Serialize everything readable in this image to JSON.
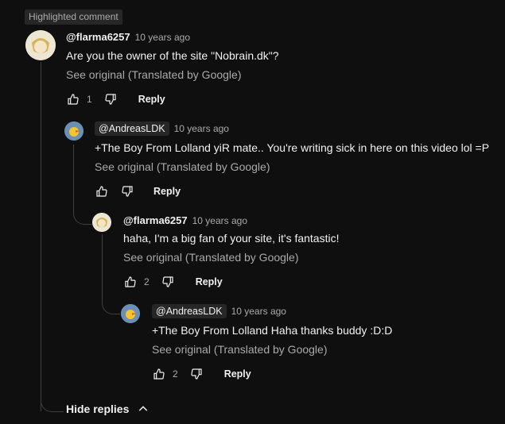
{
  "highlight_badge": "Highlighted comment",
  "comments": [
    {
      "author": "@flarma6257",
      "time": "10 years ago",
      "text": "Are you the owner of the site \"Nobrain.dk\"?",
      "see_original": "See original (Translated by Google)",
      "likes": "1",
      "reply_label": "Reply"
    },
    {
      "author": "@AndreasLDK",
      "time": "10 years ago",
      "text": "+The Boy From Lolland yiR mate.. You're writing sick in here on this video lol =P",
      "see_original": "See original (Translated by Google)",
      "likes": "",
      "reply_label": "Reply"
    },
    {
      "author": "@flarma6257",
      "time": "10 years ago",
      "text": "haha, I'm a big fan of your site, it's fantastic!",
      "see_original": "See original (Translated by Google)",
      "likes": "2",
      "reply_label": "Reply"
    },
    {
      "author": "@AndreasLDK",
      "time": "10 years ago",
      "text": "+The Boy From Lolland Haha thanks buddy :D:D",
      "see_original": "See original (Translated by Google)",
      "likes": "2",
      "reply_label": "Reply"
    }
  ],
  "hide_replies_label": "Hide replies",
  "icons": {
    "like": "thumbs-up-icon",
    "dislike": "thumbs-down-icon",
    "collapse": "chevron-up-icon"
  },
  "colors": {
    "background": "#0f0f0f",
    "text": "#f1f1f1",
    "secondary_text": "#aaaaaa",
    "chip": "#272727"
  }
}
